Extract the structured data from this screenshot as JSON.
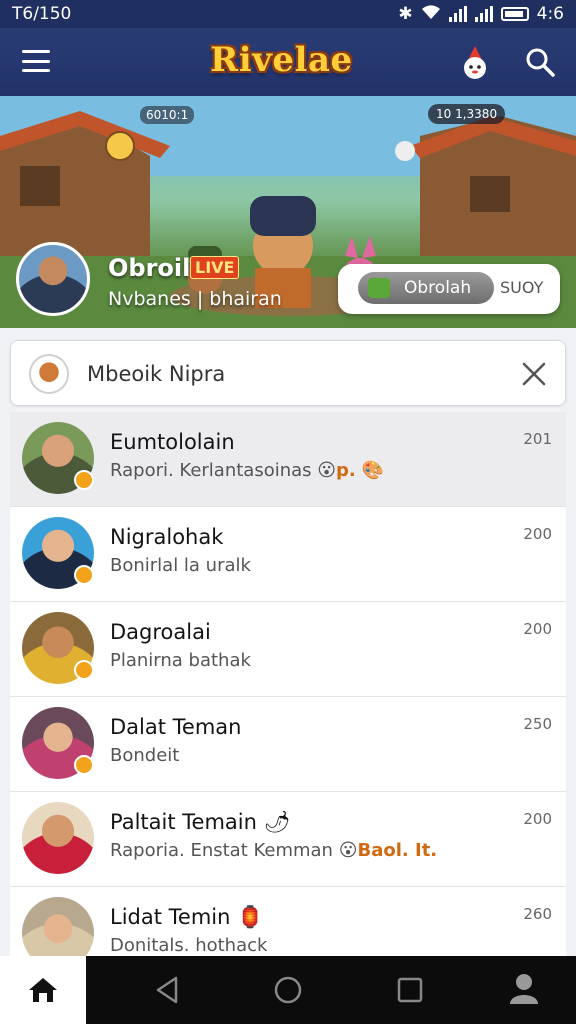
{
  "status_bar": {
    "time": "T6/150",
    "battery_text": "4:6"
  },
  "app_bar": {
    "logo_text": "Rivelae",
    "menu_icon": "hamburger-menu-icon",
    "mascot_icon": "mascot-icon",
    "search_icon": "search-icon"
  },
  "banner": {
    "stats_text": "10 1,3380",
    "top_badge": "6010:1",
    "hero_name": "Obroil",
    "live_badge": "LIVE",
    "hero_subtitle": "Nvbanes | bhairan",
    "pill_label": "Obrolah",
    "pill_extra": "SUOY"
  },
  "search": {
    "value": "Mbeoik Nipra",
    "placeholder": ""
  },
  "chats": [
    {
      "name": "Eumtololain",
      "message": "Rapori. Kerlantasoinas",
      "suffix": "p.",
      "time": "201"
    },
    {
      "name": "Nigralohak",
      "message": "Bonirlal la uralk",
      "suffix": "",
      "time": "200"
    },
    {
      "name": "Dagroalai",
      "message": "Planirna bathak",
      "suffix": "",
      "time": "200"
    },
    {
      "name": "Dalat Teman",
      "message": "Bondeit",
      "suffix": "",
      "time": "250"
    },
    {
      "name": "Paltait Temain",
      "message": "Raporia. Enstat Kemman",
      "suffix": "Baol. It.",
      "time": "200"
    },
    {
      "name": "Lidat Temin",
      "message": "Donitals. hothack",
      "suffix": "",
      "time": "260"
    }
  ]
}
